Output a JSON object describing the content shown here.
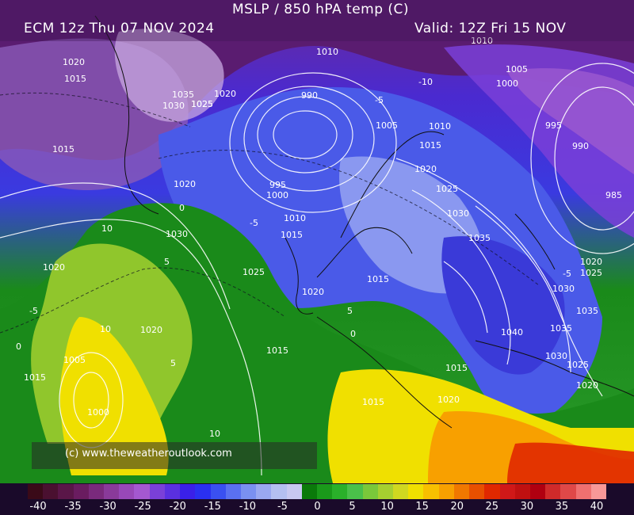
{
  "header": {
    "title": "MSLP / 850 hPA temp (C)",
    "run": "ECM 12z Thu 07 NOV 2024",
    "valid": "Valid: 12Z Fri 15 NOV"
  },
  "copyright": "(c) www.theweatheroutlook.com",
  "isobar_labels": [
    "1020",
    "1015",
    "1010",
    "1010",
    "1025",
    "1020",
    "1035",
    "1030",
    "1025",
    "1020",
    "990",
    "1005",
    "1010",
    "1005",
    "1000",
    "995",
    "990",
    "985",
    "1015",
    "995",
    "1000",
    "1020",
    "1025",
    "1010",
    "1015",
    "1015",
    "1030",
    "1035",
    "1020",
    "1025",
    "1030",
    "1015",
    "1020",
    "1020",
    "1025",
    "1030",
    "1035",
    "1040",
    "1035",
    "1030",
    "1025",
    "1020",
    "1020",
    "1015",
    "1020",
    "1005",
    "1015",
    "1000",
    "1015",
    "1015"
  ],
  "temp_labels": [
    "-5",
    "-10",
    "0",
    "5",
    "10",
    "-5",
    "0",
    "5",
    "-5",
    "0",
    "10",
    "5",
    "-5",
    "10"
  ],
  "legend": {
    "ticks": [
      "-40",
      "-35",
      "-30",
      "-25",
      "-20",
      "-15",
      "-10",
      "-5",
      "0",
      "5",
      "10",
      "15",
      "20",
      "25",
      "30",
      "35",
      "40"
    ],
    "colors": [
      "#3a0a18",
      "#4a1030",
      "#5a1648",
      "#6a1c60",
      "#7a2a7c",
      "#8a3a9a",
      "#9848b8",
      "#a458d0",
      "#7a40d8",
      "#5a30e0",
      "#3a20e8",
      "#2a30f0",
      "#3a50f0",
      "#5a70f0",
      "#7a90f0",
      "#9aa8f0",
      "#b4bff0",
      "#c8c8f0",
      "#0a7a0a",
      "#1a9a1a",
      "#2ab02a",
      "#4ac04a",
      "#7ac83a",
      "#a6d030",
      "#d0d820",
      "#f0e000",
      "#f8c000",
      "#f8a000",
      "#f07800",
      "#e85000",
      "#e02800",
      "#d01818",
      "#c01010",
      "#b00010",
      "#d02a2a",
      "#e04848",
      "#f07070",
      "#f89898"
    ],
    "accent": "#ffffff"
  }
}
